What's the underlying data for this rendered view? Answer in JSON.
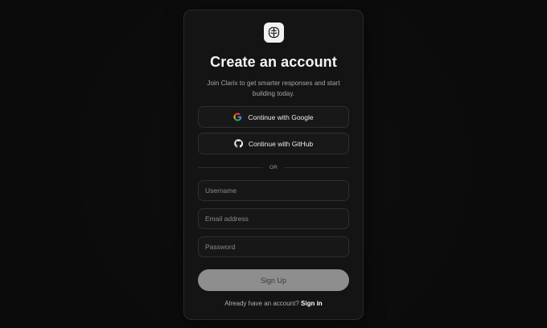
{
  "header": {
    "logo_icon": "brain-icon",
    "title": "Create an account",
    "subtitle": "Join Clarix to get smarter responses and start building today."
  },
  "oauth": {
    "google_label": "Continue with Google",
    "google_icon": "google-icon",
    "github_label": "Continue with GitHub",
    "github_icon": "github-icon"
  },
  "divider": {
    "label": "OR"
  },
  "form": {
    "username_placeholder": "Username",
    "email_placeholder": "Email address",
    "password_placeholder": "Password",
    "submit_label": "Sign Up"
  },
  "footer": {
    "prompt": "Already have an account?",
    "link_label": "Sign in"
  },
  "colors": {
    "background": "#0b0b0b",
    "card": "#141414",
    "submit_button": "#8e8e8e"
  }
}
